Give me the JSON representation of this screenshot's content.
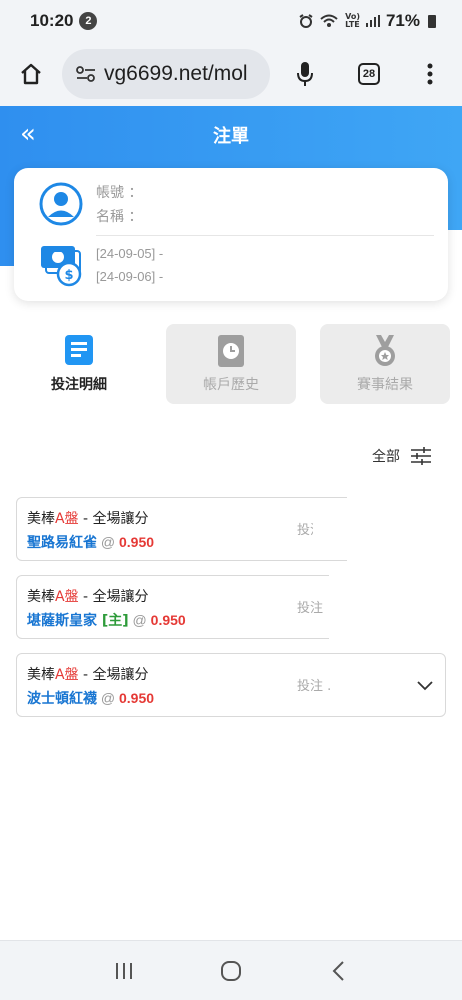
{
  "status_bar": {
    "time": "10:20",
    "notification_count": "2",
    "battery": "71%"
  },
  "browser": {
    "url": "vg6699.net/mol",
    "tab_count": "28"
  },
  "header": {
    "back_icon": "«",
    "title": "注單"
  },
  "account": {
    "account_label": "帳號 ：",
    "name_label": "名稱 ：",
    "date_from": "[24-09-05] -",
    "date_to": "[24-09-06] -"
  },
  "tabs": [
    {
      "label": "投注明細",
      "icon": "document-icon",
      "active": true
    },
    {
      "label": "帳戶歷史",
      "icon": "clock-book-icon",
      "active": false
    },
    {
      "label": "賽事結果",
      "icon": "medal-icon",
      "active": false
    }
  ],
  "filter": {
    "label": "全部",
    "icon": "sliders-icon"
  },
  "bets": [
    {
      "league_prefix": "美棒",
      "league_a": "A盤",
      "bet_type": " - 全場讓分",
      "team": "聖路易紅雀",
      "home_tag": "",
      "at": " @ ",
      "odds": "0.950",
      "status": "投注"
    },
    {
      "league_prefix": "美棒",
      "league_a": "A盤",
      "bet_type": " - 全場讓分",
      "team": "堪薩斯皇家",
      "home_tag": " [主]",
      "at": " @ ",
      "odds": "0.950",
      "status": "投注"
    },
    {
      "league_prefix": "美棒",
      "league_a": "A盤",
      "bet_type": " - 全場讓分",
      "team": "波士頓紅襪",
      "home_tag": "",
      "at": " @ ",
      "odds": "0.950",
      "status": "投注 ."
    }
  ],
  "colors": {
    "primary": "#2f8fef",
    "accent_red": "#e53935",
    "team_blue": "#1976d2",
    "home_green": "#2e9b3a"
  }
}
